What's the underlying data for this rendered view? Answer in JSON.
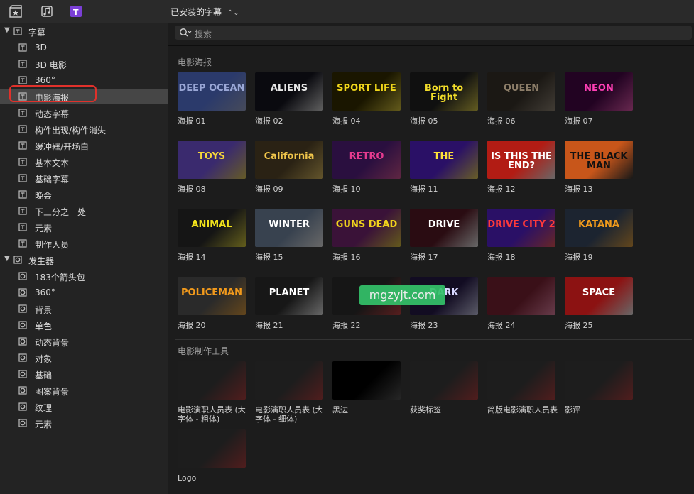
{
  "toolbar": {
    "library_title": "已安装的字幕"
  },
  "search": {
    "placeholder": "搜索"
  },
  "sidebar": {
    "titles_root": "字幕",
    "titles_items": [
      "3D",
      "3D 电影",
      "360°",
      "电影海报",
      "动态字幕",
      "构件出现/构件消失",
      "缓冲器/开场白",
      "基本文本",
      "基础字幕",
      "晚会",
      "下三分之一处",
      "元素",
      "制作人员"
    ],
    "selected": "电影海报",
    "generators_root": "发生器",
    "generator_items": [
      "183个箭头包",
      "360°",
      "背景",
      "单色",
      "动态背景",
      "对象",
      "基础",
      "图案背景",
      "纹理",
      "元素"
    ]
  },
  "sections": [
    {
      "header": "电影海报",
      "items": [
        {
          "caption": "海报 01",
          "thumb_text": "DEEP OCEAN",
          "colors": [
            "#2b3a6b",
            "#9aa7d6"
          ]
        },
        {
          "caption": "海报 02",
          "thumb_text": "ALIENS",
          "colors": [
            "#0a0a0f",
            "#e8e8e8"
          ]
        },
        {
          "caption": "海报 04",
          "thumb_text": "SPORT LIFE",
          "colors": [
            "#1a1600",
            "#f0d61a"
          ]
        },
        {
          "caption": "海报 05",
          "thumb_text": "Born to Fight",
          "colors": [
            "#101010",
            "#f2dc2a"
          ]
        },
        {
          "caption": "海报 06",
          "thumb_text": "QUEEN",
          "colors": [
            "#1b1814",
            "#8c7d68"
          ]
        },
        {
          "caption": "海报 07",
          "thumb_text": "NEON",
          "colors": [
            "#220322",
            "#ff3fb5"
          ]
        },
        {
          "caption": "海报 08",
          "thumb_text": "TOYS",
          "colors": [
            "#3a2a6e",
            "#f6d73a"
          ]
        },
        {
          "caption": "海报 09",
          "thumb_text": "California",
          "colors": [
            "#2a2214",
            "#f1c64b"
          ]
        },
        {
          "caption": "海报 10",
          "thumb_text": "RETRO",
          "colors": [
            "#2a0f3f",
            "#e43a8e"
          ]
        },
        {
          "caption": "海报 11",
          "thumb_text": "THE",
          "colors": [
            "#2a1066",
            "#ffe23a"
          ]
        },
        {
          "caption": "海报 12",
          "thumb_text": "IS THIS THE END?",
          "colors": [
            "#b21c14",
            "#ffffff"
          ]
        },
        {
          "caption": "海报 13",
          "thumb_text": "THE BLACK MAN",
          "colors": [
            "#c8561a",
            "#111111"
          ]
        },
        {
          "caption": "海报 14",
          "thumb_text": "ANIMAL",
          "colors": [
            "#151515",
            "#f1e21b"
          ]
        },
        {
          "caption": "海报 15",
          "thumb_text": "WINTER",
          "colors": [
            "#38424f",
            "#ffffff"
          ]
        },
        {
          "caption": "海报 16",
          "thumb_text": "GUNS DEAD",
          "colors": [
            "#3a1238",
            "#f0d21c"
          ]
        },
        {
          "caption": "海报 17",
          "thumb_text": "DRIVE",
          "colors": [
            "#2a0c12",
            "#ffffff"
          ]
        },
        {
          "caption": "海报 18",
          "thumb_text": "DRIVE CITY 2",
          "colors": [
            "#2a1066",
            "#ff3a3a"
          ]
        },
        {
          "caption": "海报 19",
          "thumb_text": "KATANA",
          "colors": [
            "#1c2430",
            "#f09a1c"
          ]
        },
        {
          "caption": "海报 20",
          "thumb_text": "POLICEMAN",
          "colors": [
            "#2a2a2a",
            "#f29a1c"
          ]
        },
        {
          "caption": "海报 21",
          "thumb_text": "PLANET",
          "colors": [
            "#171717",
            "#ffffff"
          ]
        },
        {
          "caption": "海报 22",
          "thumb_text": "",
          "colors": [
            "#161616",
            "#cc2222"
          ]
        },
        {
          "caption": "海报 23",
          "thumb_text": "DARK",
          "colors": [
            "#120c22",
            "#d8d8ff"
          ]
        },
        {
          "caption": "海报 24",
          "thumb_text": "",
          "colors": [
            "#3a1018",
            "#ff7aa8"
          ]
        },
        {
          "caption": "海报 25",
          "thumb_text": "SPACE",
          "colors": [
            "#8c1212",
            "#ffffff"
          ]
        }
      ]
    },
    {
      "header": "电影制作工具",
      "items": [
        {
          "caption": "电影演职人员表 (大字体 - 粗体)",
          "thumb_text": "",
          "colors": [
            "#1d1d1d",
            "#b82020"
          ]
        },
        {
          "caption": "电影演职人员表 (大字体 - 细体)",
          "thumb_text": "",
          "colors": [
            "#1d1d1d",
            "#b82020"
          ]
        },
        {
          "caption": "黑边",
          "thumb_text": "",
          "colors": [
            "#000000",
            "#3a3a3a"
          ]
        },
        {
          "caption": "获奖标签",
          "thumb_text": "",
          "colors": [
            "#1d1d1d",
            "#b82020"
          ]
        },
        {
          "caption": "简版电影演职人员表",
          "thumb_text": "",
          "colors": [
            "#1d1d1d",
            "#b82020"
          ]
        },
        {
          "caption": "影评",
          "thumb_text": "",
          "colors": [
            "#1d1d1d",
            "#b82020"
          ]
        },
        {
          "caption": "Logo",
          "thumb_text": "",
          "colors": [
            "#1d1d1d",
            "#b82020"
          ]
        }
      ]
    }
  ],
  "watermark": "mgzyjt.com"
}
